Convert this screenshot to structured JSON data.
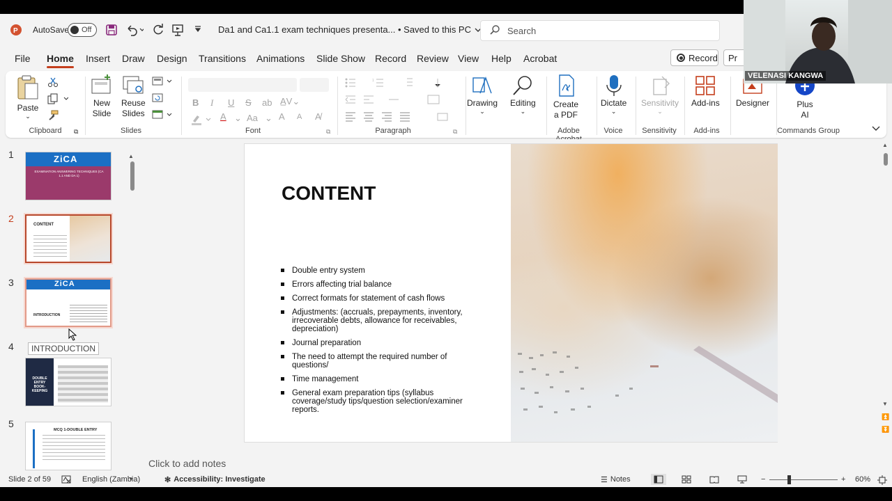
{
  "titlebar": {
    "autosave_label": "AutoSave",
    "toggle_state": "Off",
    "doc_title": "Da1 and Ca1.1 exam techniques presenta... • Saved to this PC",
    "search_placeholder": "Search"
  },
  "menu": {
    "tabs": [
      "File",
      "Home",
      "Insert",
      "Draw",
      "Design",
      "Transitions",
      "Animations",
      "Slide Show",
      "Record",
      "Review",
      "View",
      "Help",
      "Acrobat"
    ],
    "active": "Home",
    "record_button": "Record",
    "present_button": "Pr"
  },
  "ribbon": {
    "clipboard": {
      "paste": "Paste",
      "group": "Clipboard"
    },
    "slides": {
      "new_slide": "New\nSlide",
      "reuse_slides": "Reuse\nSlides",
      "group": "Slides"
    },
    "font": {
      "group": "Font",
      "bold": "B",
      "italic": "I",
      "underline": "U",
      "strike": "S",
      "font_color": "A",
      "size_up": "A",
      "size_down": "A",
      "case": "Aa"
    },
    "paragraph": {
      "group": "Paragraph"
    },
    "drawing": {
      "label": "Drawing"
    },
    "editing": {
      "label": "Editing"
    },
    "adobe": {
      "create_pdf": "Create\na PDF",
      "group": "Adobe Acrobat"
    },
    "voice": {
      "dictate": "Dictate",
      "group": "Voice"
    },
    "sensitivity": {
      "label": "Sensitivity",
      "group": "Sensitivity"
    },
    "addins": {
      "label": "Add-ins",
      "group": "Add-ins"
    },
    "designer": {
      "label": "Designer"
    },
    "plusai": {
      "label": "Plus\nAI",
      "group": "Commands Group"
    }
  },
  "slides_pane": {
    "thumbnails": [
      {
        "num": "1",
        "title": "ZiCA",
        "subtitle": "EXAMINATION ANSWERING TECHNIQUES (CA 1.1 AND DA 1)"
      },
      {
        "num": "2",
        "title": "CONTENT"
      },
      {
        "num": "3",
        "title": "ZiCA",
        "subtitle": "INTRODUCTION"
      },
      {
        "num": "4",
        "title": "DOUBLE ENTRY BOOK-KEEPING"
      },
      {
        "num": "5",
        "title": "MCQ 1-DOUBLE ENTRY"
      }
    ],
    "tooltip": "INTRODUCTION"
  },
  "slide": {
    "title": "CONTENT",
    "bullets": [
      " Double entry system",
      "Errors affecting trial balance",
      "Correct formats for statement of cash flows",
      "Adjustments: (accruals, prepayments, inventory, irrecoverable debts, allowance for receivables, depreciation)",
      "Journal preparation",
      "The need to attempt the required number of questions/",
      "Time management",
      "General exam preparation tips (syllabus coverage/study tips/question selection/examiner reports."
    ]
  },
  "notes_placeholder": "Click to add notes",
  "status": {
    "slide_count": "Slide 2 of 59",
    "language": "English (Zambia)",
    "accessibility": "Accessibility: Investigate",
    "notes_btn": "Notes",
    "zoom": "60%"
  },
  "webcam": {
    "name": "VELENASI KANGWA"
  },
  "colors": {
    "accent": "#c43e1c",
    "zica_blue": "#1b6fc4",
    "thumb_purple": "#9b3a6b",
    "thumb_navy": "#1f2a44"
  }
}
